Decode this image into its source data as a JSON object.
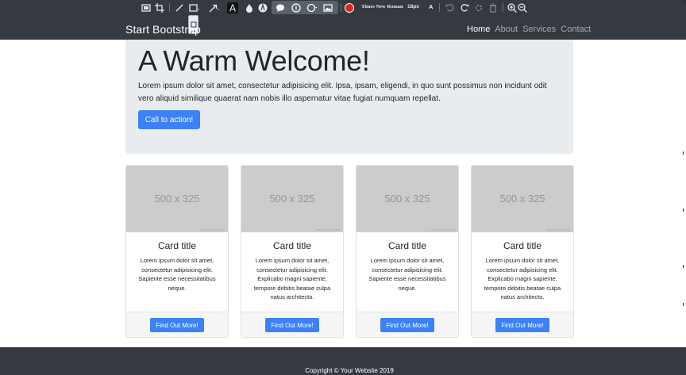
{
  "navbar": {
    "brand": "Start Bootstrap",
    "links": [
      {
        "label": "Home",
        "active": true
      },
      {
        "label": "About",
        "active": false
      },
      {
        "label": "Services",
        "active": false
      },
      {
        "label": "Contact",
        "active": false
      }
    ]
  },
  "toolbar": {
    "font_name": "Times New Roman",
    "font_size": "18px",
    "text_size_glyph": "A",
    "record_color": "#e02424",
    "icons": [
      "crop-screen-icon",
      "crop-icon",
      "line-icon",
      "rectangle-icon",
      "arrow-icon",
      "text-icon",
      "blur-icon",
      "marker-icon",
      "speech-bubble-icon",
      "step-icon",
      "magnifier-icon",
      "image-icon",
      "color-picker-icon",
      "undo-icon",
      "redo-icon",
      "reset-icon",
      "delete-icon",
      "zoom-in-icon",
      "zoom-out-icon"
    ]
  },
  "jumbotron": {
    "title": "A Warm Welcome!",
    "lead": "Lorem ipsum dolor sit amet, consectetur adipisicing elit. Ipsa, ipsam, eligendi, in quo sunt possimus non incidunt odit vero aliquid similique quaerat nam nobis illo aspernatur vitae fugiat numquam repellat.",
    "cta_label": "Call to action!"
  },
  "cards": [
    {
      "image_label": "500 x 325",
      "title": "Card title",
      "text": "Lorem ipsum dolor sit amet, consectetur adipisicing elit. Sapiente esse necessitatibus neque.",
      "button_label": "Find Out More!"
    },
    {
      "image_label": "500 x 325",
      "title": "Card title",
      "text": "Lorem ipsum dolor sit amet, consectetur adipisicing elit. Explicabo magni sapiente, tempore debitis beatae culpa natus architecto.",
      "button_label": "Find Out More!"
    },
    {
      "image_label": "500 x 325",
      "title": "Card title",
      "text": "Lorem ipsum dolor sit amet, consectetur adipisicing elit. Sapiente esse necessitatibus neque.",
      "button_label": "Find Out More!"
    },
    {
      "image_label": "500 x 325",
      "title": "Card title",
      "text": "Lorem ipsum dolor sit amet, consectetur adipisicing elit. Explicabo magni sapiente, tempore debitis beatae culpa natus architecto.",
      "button_label": "Find Out More!"
    }
  ],
  "footer": {
    "copyright": "Copyright © Your Website 2019"
  },
  "colors": {
    "navbar_bg": "#343a40",
    "primary": "#3b82f6",
    "jumbotron_bg": "#e9ecef",
    "placeholder_bg": "#cccccc"
  }
}
